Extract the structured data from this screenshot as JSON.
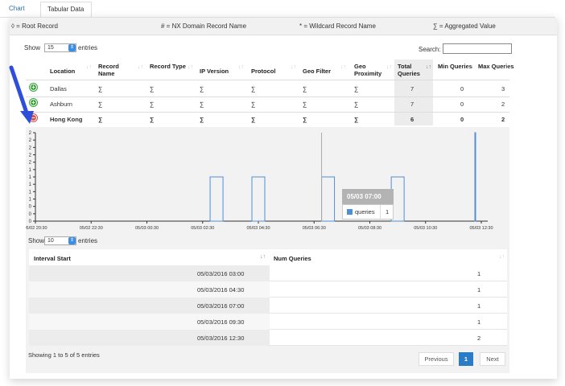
{
  "tabs": [
    {
      "label": "Chart"
    },
    {
      "label": "Tabular Data"
    }
  ],
  "legend": {
    "root": "◊ = Root Record",
    "nx": "# = NX Domain Record Name",
    "wildcard": "* = Wildcard Record Name",
    "aggregated": "∑ = Aggregated Value"
  },
  "outer": {
    "show_label": "Show",
    "show_value": "15",
    "entries_label": "entries",
    "search_label": "Search:",
    "search_value": "",
    "columns": [
      "Location",
      "Record Name",
      "Record Type",
      "IP Version",
      "Protocol",
      "Geo Filter",
      "Geo Proximity",
      "Total Queries",
      "Min Queries",
      "Max Queries"
    ],
    "rows": [
      {
        "location": "Dallas",
        "record_name": "∑",
        "record_type": "∑",
        "ip_version": "∑",
        "protocol": "∑",
        "geo_filter": "∑",
        "geo_proximity": "∑",
        "total": "7",
        "min": "0",
        "max": "3",
        "expanded": false
      },
      {
        "location": "Ashburn",
        "record_name": "∑",
        "record_type": "∑",
        "ip_version": "∑",
        "protocol": "∑",
        "geo_filter": "∑",
        "geo_proximity": "∑",
        "total": "7",
        "min": "0",
        "max": "2",
        "expanded": false
      },
      {
        "location": "Hong Kong",
        "record_name": "∑",
        "record_type": "∑",
        "ip_version": "∑",
        "protocol": "∑",
        "geo_filter": "∑",
        "geo_proximity": "∑",
        "total": "6",
        "min": "0",
        "max": "2",
        "expanded": true
      }
    ]
  },
  "chart_data": {
    "type": "bar",
    "series": [
      {
        "name": "queries",
        "values": [
          1,
          1,
          1,
          1,
          2
        ]
      }
    ],
    "x": [
      "05/03 03:00",
      "05/03 04:30",
      "05/03 07:00",
      "05/03 09:30",
      "05/03 12:30"
    ],
    "x_ticks": [
      "05/02 20:30",
      "05/02 22:30",
      "05/03 00:30",
      "05/03 02:30",
      "05/03 04:30",
      "05/03 06:30",
      "05/03 08:30",
      "05/03 10:30",
      "05/03 12:30"
    ],
    "y_ticks": [
      "0",
      "0",
      "0",
      "1",
      "1",
      "1",
      "1",
      "1",
      "2",
      "2",
      "2",
      "2",
      "2"
    ],
    "ylim": [
      0,
      2
    ],
    "tooltip": {
      "title": "05/03 07:00",
      "label": "queries",
      "value": "1"
    }
  },
  "inner": {
    "show_label": "Show",
    "show_value": "10",
    "entries_label": "entries",
    "columns": [
      "Interval Start",
      "Num Queries"
    ],
    "rows": [
      {
        "interval": "05/03/2016 03:00",
        "num": "1"
      },
      {
        "interval": "05/03/2016 04:30",
        "num": "1"
      },
      {
        "interval": "05/03/2016 07:00",
        "num": "1"
      },
      {
        "interval": "05/03/2016 09:30",
        "num": "1"
      },
      {
        "interval": "05/03/2016 12:30",
        "num": "2"
      }
    ],
    "info": "Showing 1 to 5 of 5 entries",
    "pagination": {
      "previous": "Previous",
      "page": "1",
      "next": "Next"
    }
  },
  "colors": {
    "bar": "#4f8fd6",
    "tab_active": "#2a6fb0",
    "pager_active": "#2a7cc7",
    "arrow": "#2f4fd9"
  }
}
